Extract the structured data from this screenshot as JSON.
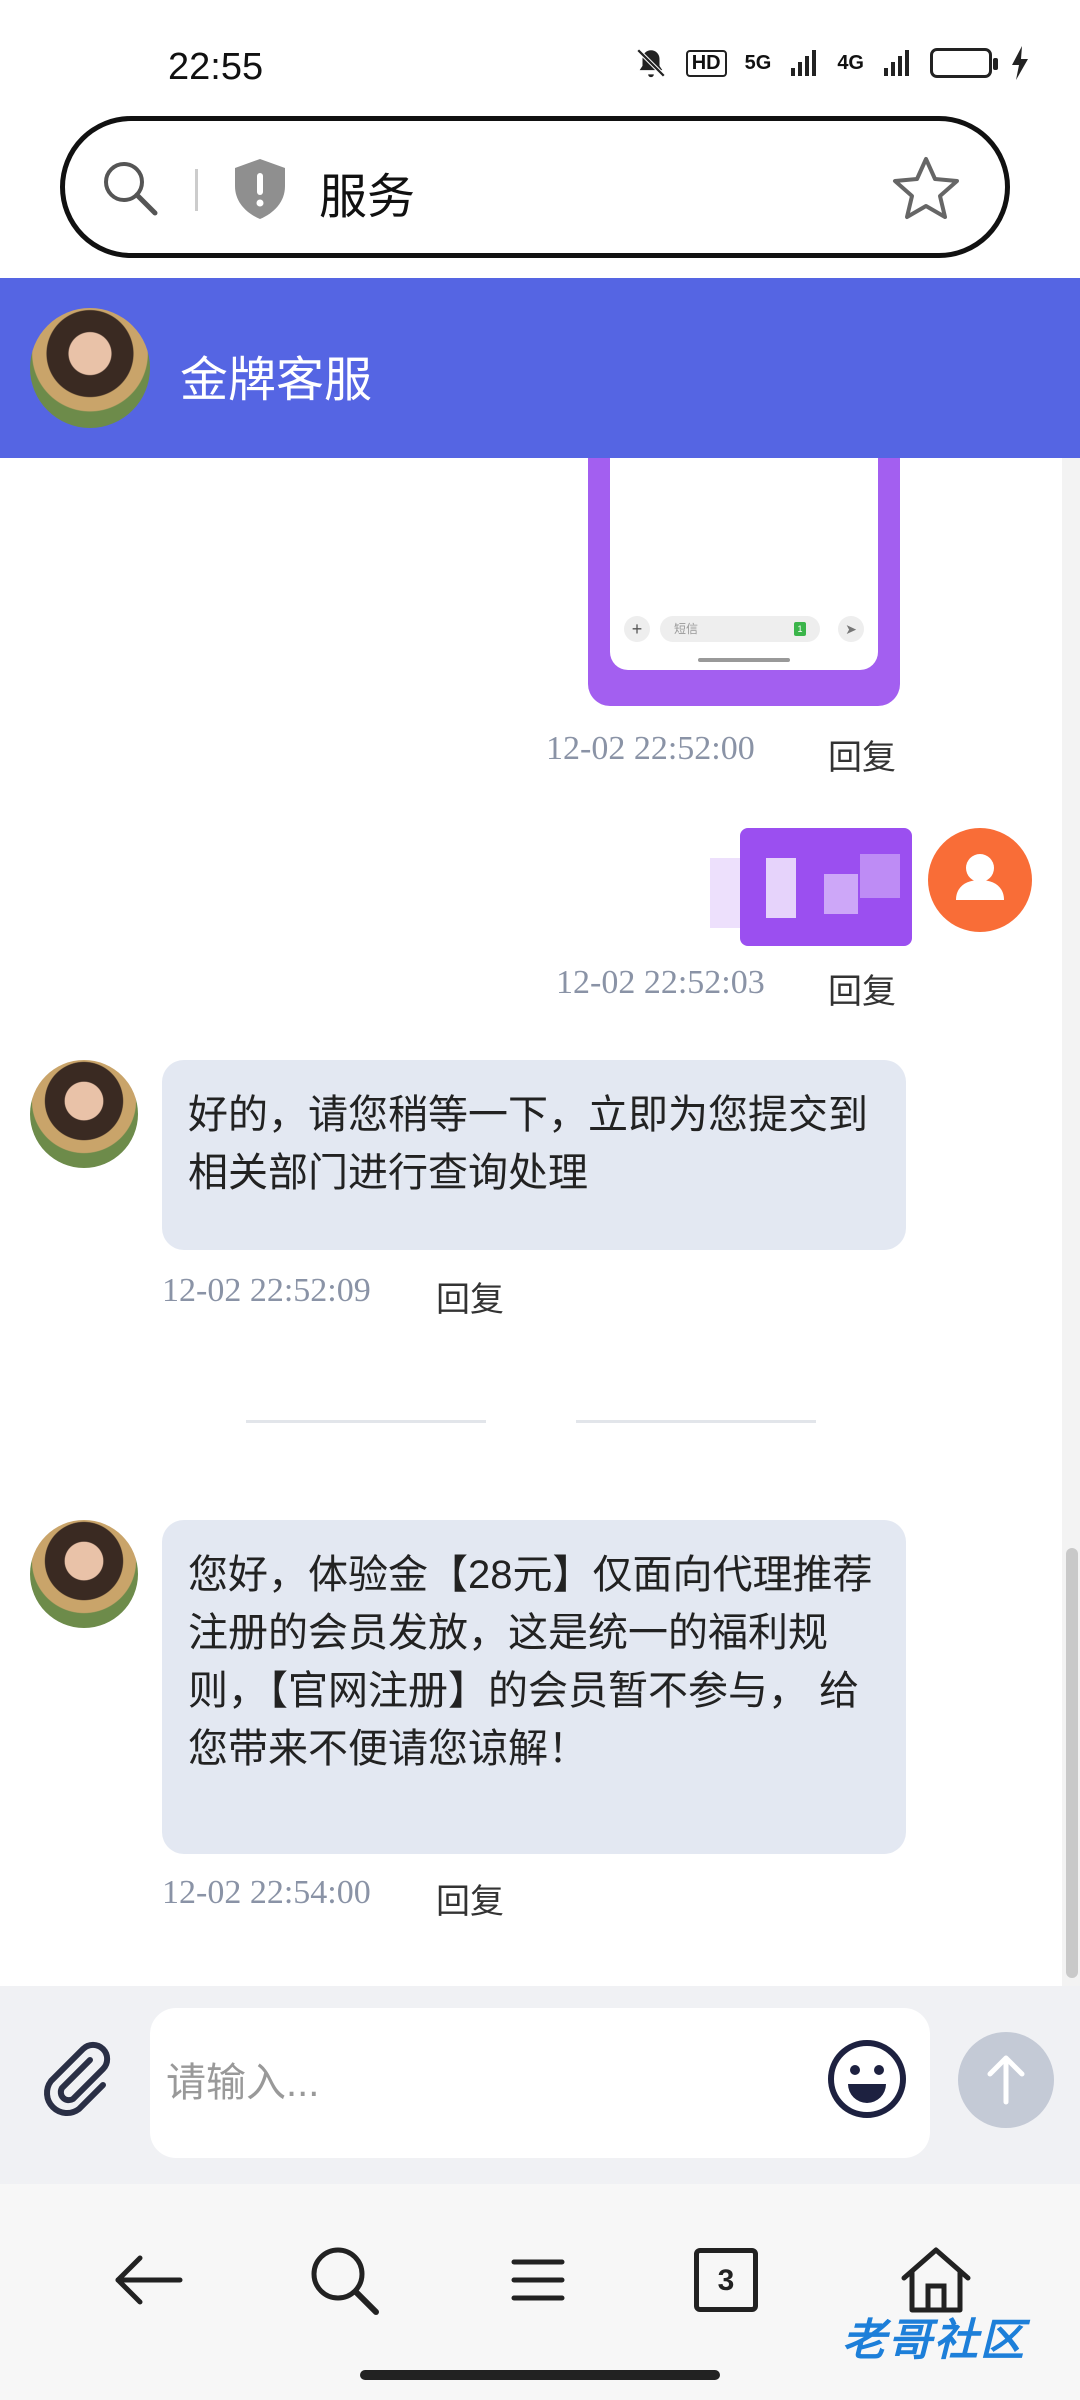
{
  "status_bar": {
    "time": "22:55",
    "network_5g": "5G",
    "network_4g": "4G",
    "hd_label": "HD"
  },
  "url_bar": {
    "text": "服务"
  },
  "chat_header": {
    "title": "金牌客服"
  },
  "phone_screenshot": {
    "field_placeholder": "短信",
    "badge": "1"
  },
  "messages": [
    {
      "timestamp": "12-02 22:52:00",
      "reply_label": "回复"
    },
    {
      "timestamp": "12-02 22:52:03",
      "reply_label": "回复"
    },
    {
      "text": "好的，请您稍等一下，立即为您提交到相关部门进行查询处理",
      "timestamp": "12-02 22:52:09",
      "reply_label": "回复"
    },
    {
      "text": "您好，体验金【28元】仅面向代理推荐注册的会员发放，这是统一的福利规则，【官网注册】的会员暂不参与， 给您带来不便请您谅解！",
      "timestamp": "12-02 22:54:00",
      "reply_label": "回复"
    }
  ],
  "input_bar": {
    "placeholder": "请输入..."
  },
  "bottom_nav": {
    "tab_count": "3"
  },
  "watermark": {
    "text": "老哥社区"
  },
  "colors": {
    "header": "#5565e3",
    "bubble": "#e3e8f2",
    "user_avatar": "#f96d37",
    "send_button": "#c4cad6"
  },
  "icons": [
    "search-icon",
    "shield-icon",
    "star-icon",
    "user-icon",
    "paperclip-icon",
    "emoji-icon",
    "arrow-up-icon",
    "back-arrow-icon",
    "menu-icon",
    "tabs-icon",
    "home-icon"
  ]
}
